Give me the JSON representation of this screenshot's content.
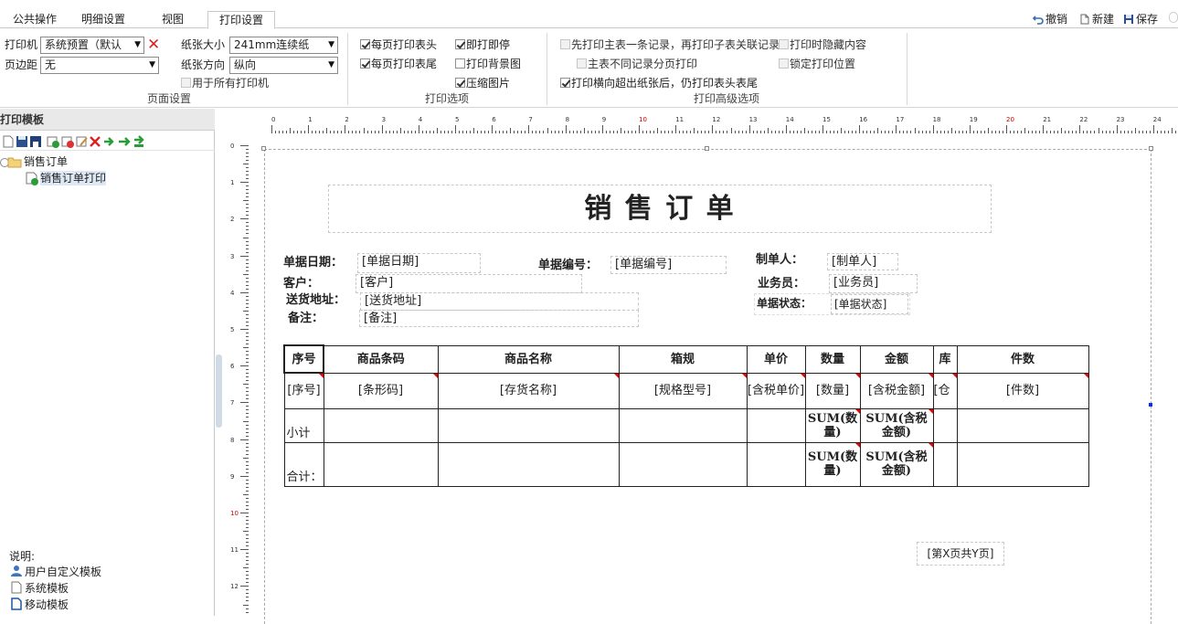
{
  "tabs": [
    {
      "label": "公共操作"
    },
    {
      "label": "明细设置"
    },
    {
      "label": "视图"
    },
    {
      "label": "打印设置"
    }
  ],
  "toolbar": {
    "undo": "撤销",
    "new": "新建",
    "save": "保存"
  },
  "ribbon": {
    "printer_label": "打印机",
    "printer_value": "系统预置（默认",
    "margin_label": "页边距",
    "margin_value": "无",
    "paper_size_label": "纸张大小",
    "paper_size_value": "241mm连续纸",
    "paper_dir_label": "纸张方向",
    "paper_dir_value": "纵向",
    "all_printers": "用于所有打印机",
    "group_page": "页面设置",
    "each_header": "每页打印表头",
    "each_footer": "每页打印表尾",
    "print_stop": "即打即停",
    "print_bg": "打印背景图",
    "compress": "压缩图片",
    "group_print": "打印选项",
    "master_first": "先打印主表一条记录，再打印子表关联记录",
    "hide_content": "打印时隐藏内容",
    "diff_page": "主表不同记录分页打印",
    "lock_pos": "锁定打印位置",
    "overflow": "打印横向超出纸张后，仍打印表头表尾",
    "group_adv": "打印高级选项"
  },
  "left": {
    "title": "打印模板",
    "tree": [
      {
        "label": "销售订单"
      },
      {
        "label": "销售订单打印"
      }
    ],
    "notes_title": "说明:",
    "notes": [
      {
        "label": "用户自定义模板"
      },
      {
        "label": "系统模板"
      },
      {
        "label": "移动模板"
      }
    ]
  },
  "ruler": {
    "h": [
      "0",
      "1",
      "2",
      "3",
      "4",
      "5",
      "6",
      "7",
      "8",
      "9",
      "10",
      "11",
      "12",
      "13",
      "14",
      "15",
      "16",
      "17",
      "18",
      "19",
      "20",
      "21",
      "22",
      "23",
      "24"
    ],
    "v": [
      "0",
      "1",
      "2",
      "3",
      "4",
      "5",
      "6",
      "7",
      "8",
      "9",
      "10",
      "11",
      "12"
    ]
  },
  "report": {
    "title": "销 售 订 单",
    "date_label": "单据日期：",
    "date_value": "[单据日期]",
    "no_label": "单据编号：",
    "no_value": "[单据编号]",
    "maker_label": "制单人：",
    "maker_value": "[制单人]",
    "customer_label": "客户：",
    "customer_value": "[客户]",
    "sales_label": "业务员：",
    "sales_value": "[业务员]",
    "addr_label": "送货地址：",
    "addr_value": "[送货地址]",
    "status_label": "单据状态：",
    "status_value": "[单据状态]",
    "memo_label": "备注：",
    "memo_value": "[备注]",
    "headers": [
      "序号",
      "商品条码",
      "商品名称",
      "箱规",
      "单价",
      "数量",
      "金额",
      "库",
      "件数"
    ],
    "row": [
      "[序号]",
      "[条形码]",
      "[存货名称]",
      "[规格型号]",
      "[含税单价]",
      "[数量]",
      "[含税金额]",
      "[仓",
      "[件数]"
    ],
    "subtotal": "小计",
    "total": "合计：",
    "sum_qty": "SUM(数量)",
    "sum_amt": "SUM(含税金额)",
    "page_no": "[第X页共Y页]"
  }
}
